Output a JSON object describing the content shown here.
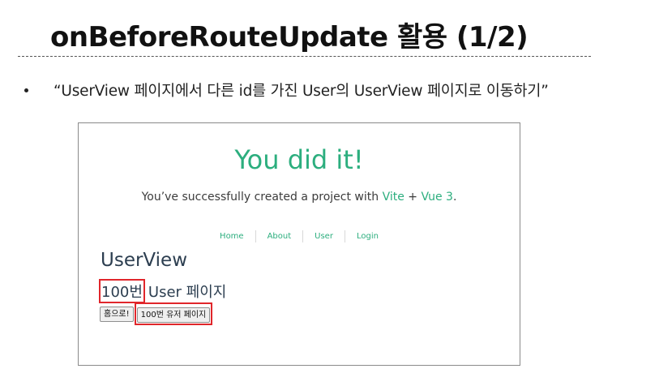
{
  "slide": {
    "title": "onBeforeRouteUpdate 활용 (1/2)",
    "bullet": "“UserView 페이지에서 다른 id를 가진 User의 UserView 페이지로 이동하기”"
  },
  "app": {
    "heading": "You did it!",
    "subheading": {
      "before": "You’ve successfully created a project with ",
      "vite": "Vite",
      "plus": " + ",
      "vue": "Vue 3",
      "end": "."
    },
    "nav": [
      {
        "label": "Home"
      },
      {
        "label": "About"
      },
      {
        "label": "User"
      },
      {
        "label": "Login"
      }
    ],
    "view_title": "UserView",
    "user_id": "100번",
    "user_page_suffix": "User 페이지",
    "buttons": {
      "home": "홈으로!",
      "user_100": "100번 유저 페이지"
    }
  },
  "colors": {
    "accent_green": "#2cae7e",
    "highlight_red": "#e0262b",
    "text_dark": "#2c3e50"
  }
}
